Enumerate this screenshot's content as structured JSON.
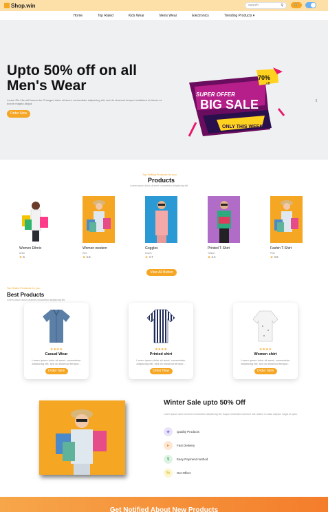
{
  "brand": {
    "name": "Shop.win"
  },
  "search": {
    "placeholder": "search"
  },
  "nav": [
    "Home",
    "Top Rated",
    "Kids Wear",
    "Mens Wear",
    "Electronics",
    "Trending Products"
  ],
  "hero": {
    "title": "Upto 50% off on all Men's Wear",
    "desc": "Lorem Ele Life will human be Changed dolor sit amet, consectetur adipiscing elit, sed do eiusmod tempor incididunt ut labore et dolore magna aliqua.",
    "button": "Order Now",
    "badge_top": "SUPER OFFER",
    "badge_main": "BIG SALE",
    "badge_bottom": "ONLY THIS WEEK",
    "badge_pct": "70%",
    "badge_off": "off"
  },
  "products": {
    "subtitle": "Top Selling Products for you",
    "title": "Products",
    "desc": "Lorem ipsum dolor sit amet consectetur adipisicing elit.",
    "items": [
      {
        "name": "Women Ethnic",
        "color": "white",
        "rating": "5"
      },
      {
        "name": "Women western",
        "color": "Red",
        "rating": "4.5"
      },
      {
        "name": "Goggles",
        "color": "brown",
        "rating": "4.7"
      },
      {
        "name": "Printed T-Shirt",
        "color": "Yellow",
        "rating": "4.4"
      },
      {
        "name": "Fashin T-Shirt",
        "color": "Pink",
        "rating": "4.5"
      }
    ],
    "view_all": "View All Button"
  },
  "best": {
    "subtitle": "Top Rated Products for you",
    "title": "Best Products",
    "desc": "Lorem ipsum dolor sit amet consectetur adipisicing elit.",
    "items": [
      {
        "name": "Casual Wear",
        "stars": "★★★★",
        "desc": "Lorem ipsum dolor sit amet, consectetur adipiscing elit, sed do eiusmod tempor...",
        "button": "Order Now"
      },
      {
        "name": "Printed shirt",
        "stars": "★★★★",
        "desc": "Lorem ipsum dolor sit amet, consectetur adipiscing elit, sed do eiusmod tempor...",
        "button": "Order Now"
      },
      {
        "name": "Women shirt",
        "stars": "★★★★",
        "desc": "Lorem ipsum dolor sit amet, consectetur adipiscing elit, sed do eiusmod tempor...",
        "button": "Order Now"
      }
    ]
  },
  "winter": {
    "title": "Winter Sale upto 50% Off",
    "desc": "Lorem ipsum dolor sit amet consectetur adipisicing elit. Eaque reiciendis inventore iste ratione ex alias adipisci magni ut optio.",
    "features": [
      "Quality Products",
      "Fast Delivery",
      "Easy Payment method",
      "Get Offers"
    ]
  },
  "footer": {
    "title": "Get Notified About New Products"
  },
  "colors": {
    "accent": "#f5a623",
    "hero_bg": "#eff0f2",
    "topbar": "#fde0a8"
  }
}
